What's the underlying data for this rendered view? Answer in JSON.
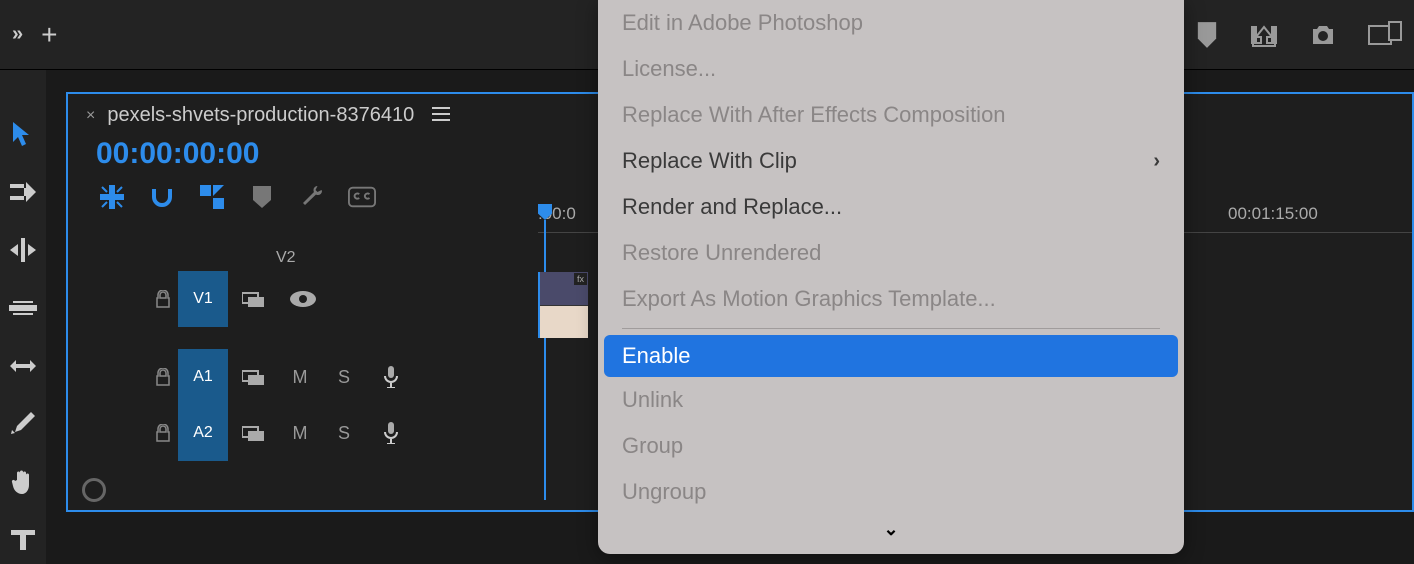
{
  "sequence": {
    "name": "pexels-shvets-production-8376410",
    "timecode": "00:00:00:00"
  },
  "ruler": {
    "start_label": ":00:0",
    "label_2": "00:01:15:00"
  },
  "tracks": {
    "v2": "V2",
    "v1": "V1",
    "a1": "A1",
    "a2": "A2",
    "m": "M",
    "s": "S"
  },
  "clip": {
    "fx": "fx"
  },
  "context_menu": {
    "items": [
      {
        "label": "Edit in Adobe Photoshop",
        "disabled": true
      },
      {
        "label": "License...",
        "disabled": true
      },
      {
        "label": "Replace With After Effects Composition",
        "disabled": true
      },
      {
        "label": "Replace With Clip",
        "submenu": true
      },
      {
        "label": "Render and Replace..."
      },
      {
        "label": "Restore Unrendered",
        "disabled": true
      },
      {
        "label": "Export As Motion Graphics Template...",
        "disabled": true
      },
      {
        "sep": true
      },
      {
        "label": "Enable",
        "selected": true
      },
      {
        "label": "Unlink",
        "disabled": true
      },
      {
        "label": "Group",
        "disabled": true
      },
      {
        "label": "Ungroup",
        "disabled": true
      }
    ]
  }
}
